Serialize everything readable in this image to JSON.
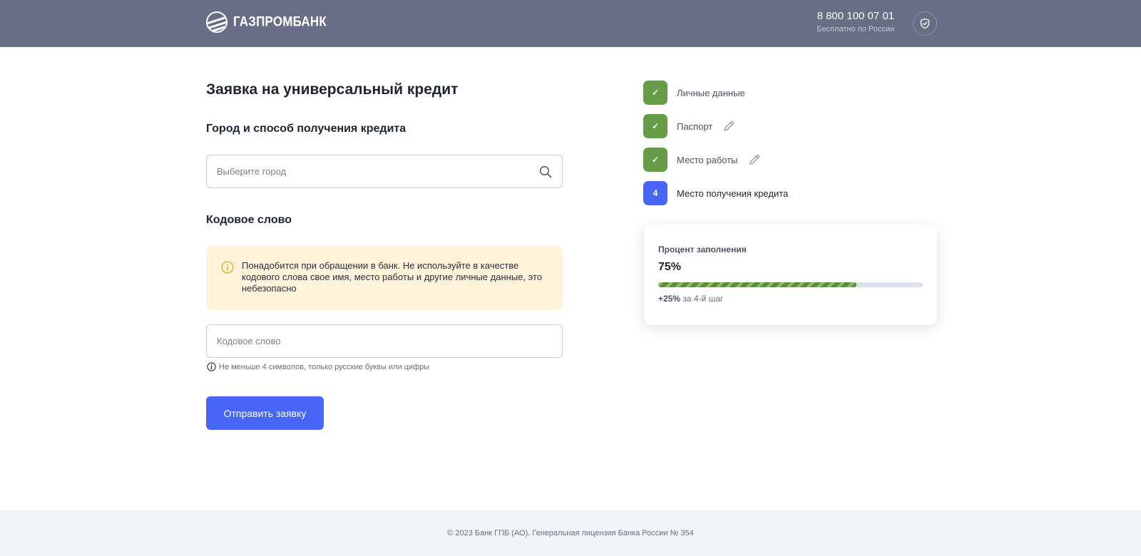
{
  "header": {
    "logo_text": "ГАЗПРОМБАНК",
    "phone": "8 800 100 07 01",
    "phone_note": "Бесплатно по России",
    "logo_icon": "gazprombank-logo-icon",
    "security_icon": "shield-check-icon"
  },
  "form": {
    "title": "Заявка на универсальный кредит",
    "city_section_title": "Город и способ получения кредита",
    "city_input": {
      "placeholder": "Выберите город",
      "value": ""
    },
    "codeword_section_title": "Кодовое слово",
    "alert_text": "Понадобится при обращении в банк. Не используйте в качестве кодового слова свое имя, место работы и другие личные данные, это небезопасно",
    "codeword_input": {
      "placeholder": "Кодовое слово",
      "value": ""
    },
    "hint": "Не меньше 4 символов, только русские буквы или цифры",
    "submit_label": "Отправить заявку"
  },
  "steps": [
    {
      "label": "Личные данные",
      "status": "done",
      "marker": "✓",
      "editable": false
    },
    {
      "label": "Паспорт",
      "status": "done",
      "marker": "✓",
      "editable": true
    },
    {
      "label": "Место работы",
      "status": "done",
      "marker": "✓",
      "editable": true
    },
    {
      "label": "Место получения кредита",
      "status": "current",
      "marker": "4",
      "editable": false
    }
  ],
  "progress": {
    "title": "Процент заполнения",
    "value_label": "75%",
    "value_fraction": 0.75,
    "increment": "+25%",
    "increment_note": "за 4-й шаг"
  },
  "footer": {
    "text": "© 2023 Банк ГПБ (АО). Генеральная лицензия Банка России № 354"
  },
  "colors": {
    "header_bg": "#686e85",
    "accent": "#4766f5",
    "success": "#669c47",
    "alert_bg": "#fff4d9",
    "alert_icon": "#f0a91e"
  }
}
